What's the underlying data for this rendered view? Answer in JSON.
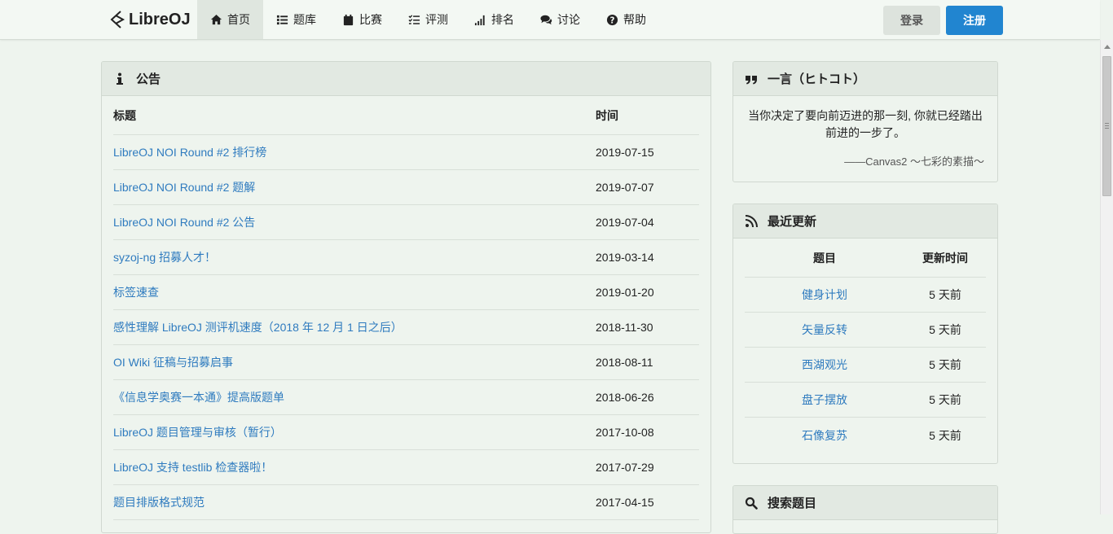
{
  "brand": {
    "name": "LibreOJ"
  },
  "nav": {
    "items": [
      {
        "label": "首页",
        "icon": "home-icon",
        "active": true
      },
      {
        "label": "题库",
        "icon": "list-icon"
      },
      {
        "label": "比赛",
        "icon": "calendar-icon"
      },
      {
        "label": "评测",
        "icon": "tasks-icon"
      },
      {
        "label": "排名",
        "icon": "signal-icon"
      },
      {
        "label": "讨论",
        "icon": "comments-icon"
      },
      {
        "label": "帮助",
        "icon": "help-icon"
      }
    ]
  },
  "auth": {
    "login": "登录",
    "register": "注册"
  },
  "announcements": {
    "title": "公告",
    "col_title": "标题",
    "col_time": "时间",
    "rows": [
      {
        "title": "LibreOJ NOI Round #2 排行榜",
        "date": "2019-07-15"
      },
      {
        "title": "LibreOJ NOI Round #2 题解",
        "date": "2019-07-07"
      },
      {
        "title": "LibreOJ NOI Round #2 公告",
        "date": "2019-07-04"
      },
      {
        "title": "syzoj-ng 招募人才！",
        "date": "2019-03-14"
      },
      {
        "title": "标签速查",
        "date": "2019-01-20"
      },
      {
        "title": "感性理解 LibreOJ 测评机速度（2018 年 12 月 1 日之后）",
        "date": "2018-11-30"
      },
      {
        "title": "OI Wiki 征稿与招募启事",
        "date": "2018-08-11"
      },
      {
        "title": "《信息学奥赛一本通》提高版题单",
        "date": "2018-06-26"
      },
      {
        "title": "LibreOJ 题目管理与审核（暂行）",
        "date": "2017-10-08"
      },
      {
        "title": "LibreOJ 支持 testlib 检查器啦！",
        "date": "2017-07-29"
      },
      {
        "title": "题目排版格式规范",
        "date": "2017-04-15"
      }
    ]
  },
  "hitokoto": {
    "title": "一言（ヒトコト）",
    "text": "当你决定了要向前迈进的那一刻, 你就已经踏出前进的一步了。",
    "source": "——Canvas2 ～七彩的素描～"
  },
  "recent": {
    "title": "最近更新",
    "col_problem": "题目",
    "col_time": "更新时间",
    "rows": [
      {
        "name": "健身计划",
        "time": "5 天前"
      },
      {
        "name": "矢量反转",
        "time": "5 天前"
      },
      {
        "name": "西湖观光",
        "time": "5 天前"
      },
      {
        "name": "盘子摆放",
        "time": "5 天前"
      },
      {
        "name": "石像复苏",
        "time": "5 天前"
      }
    ]
  },
  "search": {
    "title": "搜索题目"
  },
  "colors": {
    "accent": "#2185d0",
    "link": "#2f7bbf",
    "background": "#eef4ee"
  }
}
